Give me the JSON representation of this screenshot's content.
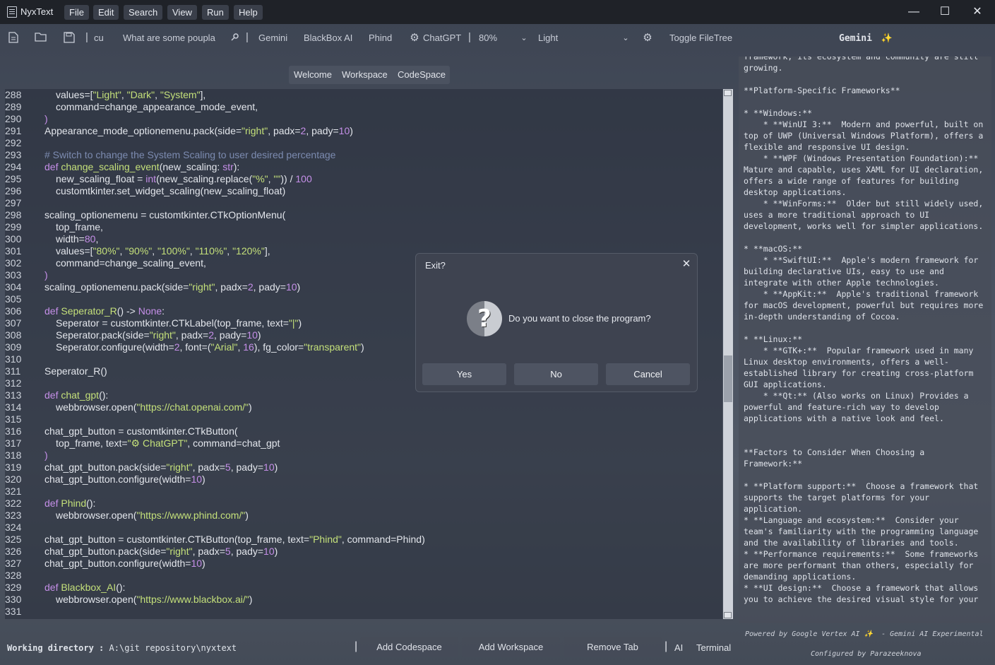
{
  "app": {
    "title": "NyxText",
    "menus": [
      "File",
      "Edit",
      "Search",
      "View",
      "Run",
      "Help"
    ],
    "window_controls": {
      "minimize": "—",
      "maximize": "☐",
      "close": "✕"
    }
  },
  "toolbar": {
    "icons": [
      "new-file-icon",
      "open-folder-icon",
      "save-icon"
    ],
    "cursor_text": "cu",
    "search_value": "What are some poupla",
    "ai_buttons": [
      "Gemini",
      "BlackBox AI",
      "Phind"
    ],
    "chatgpt_label": "ChatGPT",
    "zoom_value": "80%",
    "theme_value": "Light",
    "toggle_filetree_label": "Toggle FileTree"
  },
  "ai_header": "Gemini",
  "tabs": [
    "Welcome",
    "Workspace",
    "CodeSpace"
  ],
  "editor": {
    "lines": [
      {
        "n": "288",
        "i": 1,
        "t": [
          [
            "values=[",
            "code"
          ],
          [
            "\"Light\"",
            "s"
          ],
          [
            ", ",
            "code"
          ],
          [
            "\"Dark\"",
            "s"
          ],
          [
            ", ",
            "code"
          ],
          [
            "\"System\"",
            "s"
          ],
          [
            "],",
            "code"
          ]
        ]
      },
      {
        "n": "289",
        "i": 1,
        "t": [
          [
            "command=change_appearance_mode_event,",
            "code"
          ]
        ]
      },
      {
        "n": "290",
        "i": 0,
        "t": [
          [
            ")",
            "k"
          ]
        ]
      },
      {
        "n": "291",
        "i": 0,
        "t": [
          [
            "Appearance_mode_optionemenu.pack(side=",
            "code"
          ],
          [
            "\"right\"",
            "s"
          ],
          [
            ", padx=",
            "code"
          ],
          [
            "2",
            "k"
          ],
          [
            ", pady=",
            "code"
          ],
          [
            "10",
            "k"
          ],
          [
            ")",
            "code"
          ]
        ]
      },
      {
        "n": "292",
        "i": 0,
        "t": []
      },
      {
        "n": "293",
        "i": 0,
        "t": [
          [
            "# Switch to change the System Scaling to user desired percentage",
            "c"
          ]
        ]
      },
      {
        "n": "294",
        "i": 0,
        "t": [
          [
            "def ",
            "k"
          ],
          [
            "change_scaling_event",
            "s"
          ],
          [
            "(new_scaling: ",
            "code"
          ],
          [
            "str",
            "k"
          ],
          [
            "):",
            "code"
          ]
        ]
      },
      {
        "n": "295",
        "i": 1,
        "t": [
          [
            "new_scaling_float = ",
            "code"
          ],
          [
            "int",
            "k"
          ],
          [
            "(new_scaling.replace(",
            "code"
          ],
          [
            "\"%\"",
            "s"
          ],
          [
            ", ",
            "code"
          ],
          [
            "\"\"",
            "s"
          ],
          [
            ")) / ",
            "code"
          ],
          [
            "100",
            "k"
          ]
        ]
      },
      {
        "n": "296",
        "i": 1,
        "t": [
          [
            "customtkinter.set_widget_scaling(new_scaling_float)",
            "code"
          ]
        ]
      },
      {
        "n": "297",
        "i": 0,
        "t": []
      },
      {
        "n": "298",
        "i": 0,
        "t": [
          [
            "scaling_optionemenu = customtkinter.CTkOptionMenu(",
            "code"
          ]
        ]
      },
      {
        "n": "299",
        "i": 1,
        "t": [
          [
            "top_frame,",
            "code"
          ]
        ]
      },
      {
        "n": "300",
        "i": 1,
        "t": [
          [
            "width=",
            "code"
          ],
          [
            "80",
            "k"
          ],
          [
            ",",
            "code"
          ]
        ]
      },
      {
        "n": "301",
        "i": 1,
        "t": [
          [
            "values=[",
            "code"
          ],
          [
            "\"80%\"",
            "s"
          ],
          [
            ", ",
            "code"
          ],
          [
            "\"90%\"",
            "s"
          ],
          [
            ", ",
            "code"
          ],
          [
            "\"100%\"",
            "s"
          ],
          [
            ", ",
            "code"
          ],
          [
            "\"110%\"",
            "s"
          ],
          [
            ", ",
            "code"
          ],
          [
            "\"120%\"",
            "s"
          ],
          [
            "],",
            "code"
          ]
        ]
      },
      {
        "n": "302",
        "i": 1,
        "t": [
          [
            "command=change_scaling_event,",
            "code"
          ]
        ]
      },
      {
        "n": "303",
        "i": 0,
        "t": [
          [
            ")",
            "k"
          ]
        ]
      },
      {
        "n": "304",
        "i": 0,
        "t": [
          [
            "scaling_optionemenu.pack(side=",
            "code"
          ],
          [
            "\"right\"",
            "s"
          ],
          [
            ", padx=",
            "code"
          ],
          [
            "2",
            "k"
          ],
          [
            ", pady=",
            "code"
          ],
          [
            "10",
            "k"
          ],
          [
            ")",
            "code"
          ]
        ]
      },
      {
        "n": "305",
        "i": 0,
        "t": []
      },
      {
        "n": "306",
        "i": 0,
        "t": [
          [
            "def ",
            "k"
          ],
          [
            "Seperator_R",
            "s"
          ],
          [
            "() -> ",
            "code"
          ],
          [
            "None",
            "k"
          ],
          [
            ":",
            "code"
          ]
        ]
      },
      {
        "n": "307",
        "i": 1,
        "t": [
          [
            "Seperator = customtkinter.CTkLabel(top_frame, text=",
            "code"
          ],
          [
            "\"|\"",
            "s"
          ],
          [
            ")",
            "code"
          ]
        ]
      },
      {
        "n": "308",
        "i": 1,
        "t": [
          [
            "Seperator.pack(side=",
            "code"
          ],
          [
            "\"right\"",
            "s"
          ],
          [
            ", padx=",
            "code"
          ],
          [
            "2",
            "k"
          ],
          [
            ", pady=",
            "code"
          ],
          [
            "10",
            "k"
          ],
          [
            ")",
            "code"
          ]
        ]
      },
      {
        "n": "309",
        "i": 1,
        "t": [
          [
            "Seperator.configure(width=",
            "code"
          ],
          [
            "2",
            "k"
          ],
          [
            ", font=(",
            "code"
          ],
          [
            "\"Arial\"",
            "s"
          ],
          [
            ", ",
            "code"
          ],
          [
            "16",
            "k"
          ],
          [
            "), fg_color=",
            "code"
          ],
          [
            "\"transparent\"",
            "s"
          ],
          [
            ")",
            "code"
          ]
        ]
      },
      {
        "n": "310",
        "i": 0,
        "t": []
      },
      {
        "n": "311",
        "i": 0,
        "t": [
          [
            "Seperator_R()",
            "code"
          ]
        ]
      },
      {
        "n": "312",
        "i": 0,
        "t": []
      },
      {
        "n": "313",
        "i": 0,
        "t": [
          [
            "def ",
            "k"
          ],
          [
            "chat_gpt",
            "s"
          ],
          [
            "():",
            "code"
          ]
        ]
      },
      {
        "n": "314",
        "i": 1,
        "t": [
          [
            "webbrowser.open(",
            "code"
          ],
          [
            "\"https://chat.openai.com/\"",
            "s"
          ],
          [
            ")",
            "code"
          ]
        ]
      },
      {
        "n": "315",
        "i": 0,
        "t": []
      },
      {
        "n": "316",
        "i": 0,
        "t": [
          [
            "chat_gpt_button = customtkinter.CTkButton(",
            "code"
          ]
        ]
      },
      {
        "n": "317",
        "i": 1,
        "t": [
          [
            "top_frame, text=",
            "code"
          ],
          [
            "\"⚙ ChatGPT\"",
            "s"
          ],
          [
            ", command=chat_gpt",
            "code"
          ]
        ]
      },
      {
        "n": "318",
        "i": 0,
        "t": [
          [
            ")",
            "k"
          ]
        ]
      },
      {
        "n": "319",
        "i": 0,
        "t": [
          [
            "chat_gpt_button.pack(side=",
            "code"
          ],
          [
            "\"right\"",
            "s"
          ],
          [
            ", padx=",
            "code"
          ],
          [
            "5",
            "k"
          ],
          [
            ", pady=",
            "code"
          ],
          [
            "10",
            "k"
          ],
          [
            ")",
            "code"
          ]
        ]
      },
      {
        "n": "320",
        "i": 0,
        "t": [
          [
            "chat_gpt_button.configure(width=",
            "code"
          ],
          [
            "10",
            "k"
          ],
          [
            ")",
            "code"
          ]
        ]
      },
      {
        "n": "321",
        "i": 0,
        "t": []
      },
      {
        "n": "322",
        "i": 0,
        "t": [
          [
            "def ",
            "k"
          ],
          [
            "Phind",
            "s"
          ],
          [
            "():",
            "code"
          ]
        ]
      },
      {
        "n": "323",
        "i": 1,
        "t": [
          [
            "webbrowser.open(",
            "code"
          ],
          [
            "\"https://www.phind.com/\"",
            "s"
          ],
          [
            ")",
            "code"
          ]
        ]
      },
      {
        "n": "324",
        "i": 0,
        "t": []
      },
      {
        "n": "325",
        "i": 0,
        "t": [
          [
            "chat_gpt_button = customtkinter.CTkButton(top_frame, text=",
            "code"
          ],
          [
            "\"Phind\"",
            "s"
          ],
          [
            ", command=Phind)",
            "code"
          ]
        ]
      },
      {
        "n": "326",
        "i": 0,
        "t": [
          [
            "chat_gpt_button.pack(side=",
            "code"
          ],
          [
            "\"right\"",
            "s"
          ],
          [
            ", padx=",
            "code"
          ],
          [
            "5",
            "k"
          ],
          [
            ", pady=",
            "code"
          ],
          [
            "10",
            "k"
          ],
          [
            ")",
            "code"
          ]
        ]
      },
      {
        "n": "327",
        "i": 0,
        "t": [
          [
            "chat_gpt_button.configure(width=",
            "code"
          ],
          [
            "10",
            "k"
          ],
          [
            ")",
            "code"
          ]
        ]
      },
      {
        "n": "328",
        "i": 0,
        "t": []
      },
      {
        "n": "329",
        "i": 0,
        "t": [
          [
            "def ",
            "k"
          ],
          [
            "Blackbox_AI",
            "s"
          ],
          [
            "():",
            "code"
          ]
        ]
      },
      {
        "n": "330",
        "i": 1,
        "t": [
          [
            "webbrowser.open(",
            "code"
          ],
          [
            "\"https://www.blackbox.ai/\"",
            "s"
          ],
          [
            ")",
            "code"
          ]
        ]
      },
      {
        "n": "331",
        "i": 0,
        "t": []
      }
    ]
  },
  "ai_response": "framework, its ecosystem and community are still growing.\n\n**Platform-Specific Frameworks**\n\n* **Windows:**\n    * **WinUI 3:**  Modern and powerful, built on top of UWP (Universal Windows Platform), offers a flexible and responsive UI design.\n    * **WPF (Windows Presentation Foundation):** Mature and capable, uses XAML for UI declaration, offers a wide range of features for building desktop applications.\n    * **WinForms:**  Older but still widely used, uses a more traditional approach to UI development, works well for simpler applications.\n\n* **macOS:**\n    * **SwiftUI:**  Apple's modern framework for building declarative UIs, easy to use and integrate with other Apple technologies.\n    * **AppKit:**  Apple's traditional framework for macOS development, powerful but requires more in-depth understanding of Cocoa.\n\n* **Linux:**\n    * **GTK+:**  Popular framework used in many Linux desktop environments, offers a well-established library for creating cross-platform GUI applications.\n    * **Qt:** (Also works on Linux) Provides a powerful and feature-rich way to develop applications with a native look and feel.\n\n\n**Factors to Consider When Choosing a Framework:**\n\n* **Platform support:**  Choose a framework that supports the target platforms for your application.\n* **Language and ecosystem:**  Consider your team's familiarity with the programming language and the availability of libraries and tools.\n* **Performance requirements:**  Some frameworks are more performant than others, especially for demanding applications.\n* **UI design:**  Choose a framework that allows you to achieve the desired visual style for your",
  "ai_footer": {
    "powered_by": "Powered by Google Vertex AI ✨  - Gemini AI Experimental",
    "configured_by": "Configured by Parazeeknova"
  },
  "statusbar": {
    "workdir_label": "Working directory :",
    "workdir_value": "A:\\git repository\\nyxtext",
    "add_codespace": "Add Codespace",
    "add_workspace": "Add Workspace",
    "remove_tab": "Remove Tab",
    "ai": "AI",
    "terminal": "Terminal"
  },
  "dialog": {
    "title": "Exit?",
    "message": "Do you want to close the program?",
    "yes": "Yes",
    "no": "No",
    "cancel": "Cancel"
  }
}
